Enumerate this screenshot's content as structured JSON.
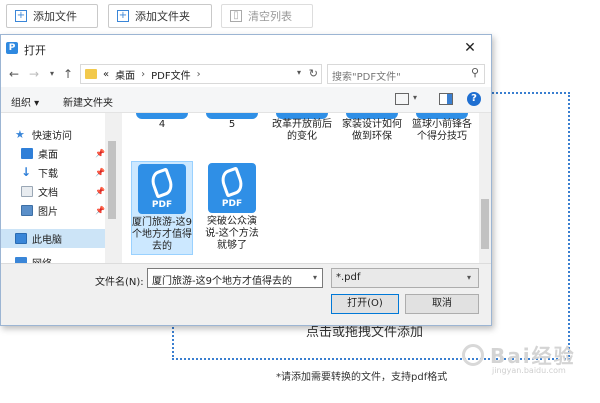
{
  "toolbar": {
    "add_file": "添加文件",
    "add_folder": "添加文件夹",
    "clear_list": "清空列表"
  },
  "dropzone": {
    "text": "点击或拖拽文件添加",
    "hint": "*请添加需要转换的文件，支持pdf格式"
  },
  "watermark": {
    "text": "Bai经验",
    "sub": "jingyan.baidu.com"
  },
  "dialog": {
    "title": "打开",
    "app_icon": "P",
    "close": "✕",
    "address": {
      "prefix": "«",
      "crumbs": [
        "桌面",
        "PDF文件"
      ],
      "refresh": "↻"
    },
    "search_placeholder": "搜索\"PDF文件\"",
    "commands": {
      "organize": "组织 ▾",
      "new_folder": "新建文件夹",
      "help": "?"
    },
    "nav": [
      {
        "label": "快速访问",
        "icon": "star-icon",
        "color": "#3a86d8",
        "pinned": false
      },
      {
        "label": "桌面",
        "icon": "desktop-icon",
        "color": "#2f7fd8",
        "pinned": true
      },
      {
        "label": "下载",
        "icon": "download-icon",
        "color": "#2f7fd8",
        "pinned": true
      },
      {
        "label": "文档",
        "icon": "document-icon",
        "color": "#9aa7b5",
        "pinned": true
      },
      {
        "label": "图片",
        "icon": "picture-icon",
        "color": "#5a8fc9",
        "pinned": true
      },
      {
        "label": "此电脑",
        "icon": "computer-icon",
        "color": "#3a86d8",
        "pinned": false
      },
      {
        "label": "网络",
        "icon": "network-icon",
        "color": "#3a86d8",
        "pinned": false
      }
    ],
    "prev_row": [
      "4",
      "5",
      "改革开放前后的变化",
      "家装设计如何做到环保",
      "篮球小前锋各个得分技巧"
    ],
    "files": [
      {
        "name": "厦门旅游-这9个地方才值得去的",
        "selected": true,
        "icon_label": "PDF"
      },
      {
        "name": "突破公众演说-这个方法就够了",
        "selected": false,
        "icon_label": "PDF"
      }
    ],
    "filename_label": "文件名(N):",
    "filename_value": "厦门旅游-这9个地方才值得去的",
    "filetype": "*.pdf",
    "open_button": "打开(O)",
    "cancel_button": "取消"
  },
  "colors": {
    "accent": "#2f8fe6",
    "selection": "#cce8ff",
    "dropzone_border": "#3a7fd0"
  }
}
